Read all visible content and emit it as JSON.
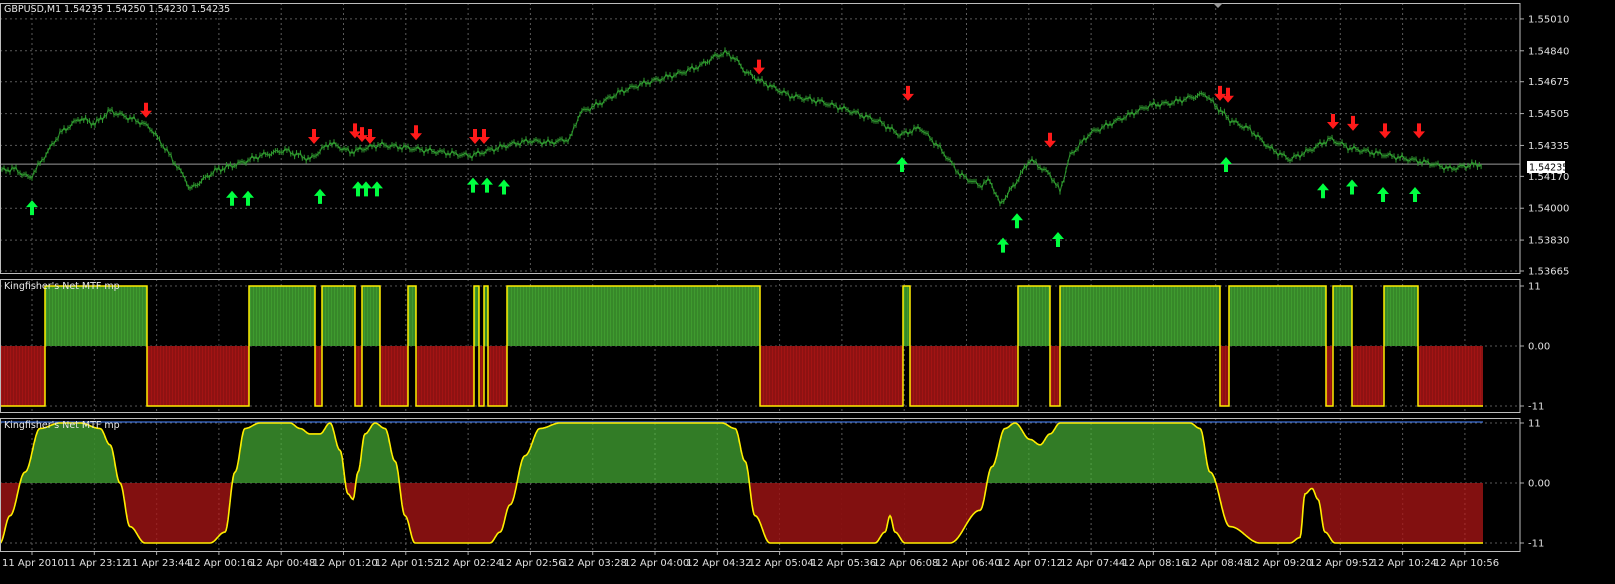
{
  "header": {
    "symbol": "GBPUSD,M1",
    "ohlc": "1.54235 1.54250 1.54230 1.54235"
  },
  "indicator_label": "Kingfisher's Net MTF mp",
  "current_price_label": "1.54235",
  "colors": {
    "background": "#000000",
    "grid": "#5a5a5a",
    "price_line": "#2f9a2f",
    "current_line": "#9a9a9a",
    "up_arrow": "#00ff40",
    "down_arrow": "#ff1a1a",
    "histo_green": "#3f9b2f",
    "histo_red": "#a31414",
    "indicator_line": "#ffee00",
    "top_line": "#3d6fd6",
    "axis_text": "#e0e0e0"
  },
  "chart_data": [
    {
      "type": "line",
      "name": "price",
      "y_ticks": [
        "1.55010",
        "1.54840",
        "1.54675",
        "1.54505",
        "1.54335",
        "1.54170",
        "1.54000",
        "1.53830",
        "1.53665"
      ],
      "ylim": [
        1.53665,
        1.55095
      ],
      "current_price": 1.54235,
      "x_labels": [
        "11 Apr 2010",
        "11 Apr 23:12",
        "11 Apr 23:44",
        "12 Apr 00:16",
        "12 Apr 00:48",
        "12 Apr 01:20",
        "12 Apr 01:52",
        "12 Apr 02:24",
        "12 Apr 02:56",
        "12 Apr 03:28",
        "12 Apr 04:00",
        "12 Apr 04:32",
        "12 Apr 05:04",
        "12 Apr 05:36",
        "12 Apr 06:08",
        "12 Apr 06:40",
        "12 Apr 07:12",
        "12 Apr 07:44",
        "12 Apr 08:16",
        "12 Apr 08:48",
        "12 Apr 09:20",
        "12 Apr 09:52",
        "12 Apr 10:24",
        "12 Apr 10:56"
      ],
      "x": [
        0,
        14,
        30,
        60,
        80,
        95,
        110,
        140,
        150,
        165,
        185,
        190,
        215,
        240,
        260,
        285,
        310,
        330,
        350,
        380,
        410,
        440,
        470,
        490,
        510,
        530,
        550,
        570,
        580,
        600,
        620,
        640,
        660,
        680,
        700,
        715,
        725,
        735,
        745,
        760,
        790,
        820,
        850,
        880,
        900,
        920,
        940,
        960,
        980,
        990,
        1000,
        1015,
        1030,
        1050,
        1060,
        1070,
        1090,
        1110,
        1130,
        1150,
        1170,
        1190,
        1205,
        1215,
        1230,
        1250,
        1270,
        1290,
        1310,
        1330,
        1350,
        1370,
        1390,
        1410,
        1430,
        1450,
        1470,
        1483
      ],
      "values": [
        1.542,
        1.5421,
        1.5416,
        1.544,
        1.5448,
        1.5445,
        1.5452,
        1.5446,
        1.5443,
        1.5432,
        1.5416,
        1.541,
        1.542,
        1.5424,
        1.5428,
        1.5431,
        1.5426,
        1.5435,
        1.543,
        1.5434,
        1.5432,
        1.543,
        1.5428,
        1.5431,
        1.5434,
        1.5436,
        1.5435,
        1.5437,
        1.5451,
        1.5456,
        1.5462,
        1.5466,
        1.5469,
        1.5472,
        1.5476,
        1.5481,
        1.5483,
        1.548,
        1.5473,
        1.5468,
        1.546,
        1.5457,
        1.5452,
        1.5446,
        1.5439,
        1.5443,
        1.5432,
        1.5418,
        1.5412,
        1.5415,
        1.5402,
        1.5413,
        1.5426,
        1.5418,
        1.5409,
        1.5428,
        1.544,
        1.5445,
        1.545,
        1.5455,
        1.5456,
        1.5459,
        1.5461,
        1.5455,
        1.5447,
        1.5442,
        1.5432,
        1.5426,
        1.5431,
        1.5437,
        1.5432,
        1.543,
        1.5428,
        1.5426,
        1.5424,
        1.5421,
        1.5423,
        1.54235
      ],
      "up_arrows": [
        [
          32,
          1.5415
        ],
        [
          232,
          1.542
        ],
        [
          248,
          1.542
        ],
        [
          320,
          1.5421
        ],
        [
          358,
          1.5425
        ],
        [
          366,
          1.5425
        ],
        [
          377,
          1.5425
        ],
        [
          473,
          1.5427
        ],
        [
          487,
          1.5427
        ],
        [
          504,
          1.5426
        ],
        [
          902,
          1.5438
        ],
        [
          1003,
          1.5395
        ],
        [
          1017,
          1.5408
        ],
        [
          1058,
          1.5398
        ],
        [
          1226,
          1.5438
        ],
        [
          1323,
          1.5424
        ],
        [
          1352,
          1.5426
        ],
        [
          1383,
          1.5422
        ],
        [
          1415,
          1.5422
        ]
      ],
      "down_arrows": [
        [
          146,
          1.5444
        ],
        [
          314,
          1.543
        ],
        [
          355,
          1.5433
        ],
        [
          362,
          1.5431
        ],
        [
          370,
          1.543
        ],
        [
          416,
          1.5432
        ],
        [
          475,
          1.543
        ],
        [
          484,
          1.543
        ],
        [
          759,
          1.5467
        ],
        [
          908,
          1.5453
        ],
        [
          1050,
          1.5428
        ],
        [
          1220,
          1.5453
        ],
        [
          1228,
          1.5452
        ],
        [
          1333,
          1.5438
        ],
        [
          1353,
          1.5437
        ],
        [
          1385,
          1.5433
        ],
        [
          1419,
          1.5433
        ]
      ]
    },
    {
      "type": "bar",
      "name": "Kingfisher's Net MTF mp",
      "y_ticks": [
        "11",
        "0.00",
        "-11"
      ],
      "ylim": [
        -11,
        11
      ],
      "x_ranges": [
        [
          0,
          45,
          -1
        ],
        [
          45,
          147,
          1
        ],
        [
          147,
          249,
          -1
        ],
        [
          249,
          315,
          1
        ],
        [
          315,
          322,
          -1
        ],
        [
          322,
          355,
          1
        ],
        [
          355,
          362,
          -1
        ],
        [
          362,
          380,
          1
        ],
        [
          380,
          408,
          -1
        ],
        [
          408,
          416,
          1
        ],
        [
          416,
          474,
          -1
        ],
        [
          474,
          479,
          1
        ],
        [
          479,
          484,
          -1
        ],
        [
          484,
          488,
          1
        ],
        [
          488,
          507,
          -1
        ],
        [
          507,
          760,
          1
        ],
        [
          760,
          903,
          -1
        ],
        [
          903,
          910,
          1
        ],
        [
          910,
          1018,
          -1
        ],
        [
          1018,
          1050,
          1
        ],
        [
          1050,
          1060,
          -1
        ],
        [
          1060,
          1220,
          1
        ],
        [
          1220,
          1229,
          -1
        ],
        [
          1229,
          1326,
          1
        ],
        [
          1326,
          1333,
          -1
        ],
        [
          1333,
          1352,
          1
        ],
        [
          1352,
          1384,
          -1
        ],
        [
          1384,
          1418,
          1
        ],
        [
          1418,
          1483,
          -1
        ]
      ]
    },
    {
      "type": "area",
      "name": "Kingfisher's Net MTF mp",
      "y_ticks": [
        "11",
        "0.00",
        "-11"
      ],
      "ylim": [
        -11,
        11
      ],
      "x": [
        0,
        10,
        25,
        40,
        60,
        80,
        100,
        110,
        120,
        130,
        145,
        160,
        175,
        190,
        210,
        225,
        235,
        245,
        260,
        275,
        290,
        300,
        310,
        320,
        330,
        340,
        348,
        353,
        358,
        365,
        375,
        385,
        395,
        405,
        415,
        430,
        445,
        460,
        475,
        490,
        500,
        510,
        525,
        540,
        560,
        600,
        650,
        700,
        722,
        735,
        745,
        755,
        770,
        800,
        830,
        860,
        875,
        885,
        890,
        895,
        905,
        920,
        950,
        980,
        992,
        1005,
        1015,
        1030,
        1040,
        1050,
        1060,
        1080,
        1120,
        1160,
        1190,
        1200,
        1210,
        1230,
        1260,
        1290,
        1300,
        1305,
        1312,
        1318,
        1325,
        1335,
        1350,
        1380,
        1420,
        1450,
        1483
      ],
      "values": [
        -11,
        -6,
        2,
        10,
        11,
        11,
        10,
        7,
        0,
        -8,
        -11,
        -11,
        -11,
        -11,
        -11,
        -9,
        2,
        10,
        11,
        11,
        11,
        10,
        9,
        9,
        11,
        6,
        -2,
        -3,
        2,
        9,
        11,
        10,
        4,
        -6,
        -11,
        -11,
        -11,
        -11,
        -11,
        -11,
        -9,
        -4,
        5,
        10,
        11,
        11,
        11,
        11,
        11,
        10,
        4,
        -6,
        -11,
        -11,
        -11,
        -11,
        -11,
        -9,
        -6,
        -9,
        -11,
        -11,
        -11,
        -5,
        3,
        10,
        11,
        8,
        7,
        9,
        11,
        11,
        11,
        11,
        11,
        10,
        2,
        -8,
        -11,
        -11,
        -10,
        -2,
        -1,
        -3,
        -9,
        -11,
        -11,
        -11,
        -11,
        -11,
        -11
      ]
    }
  ]
}
